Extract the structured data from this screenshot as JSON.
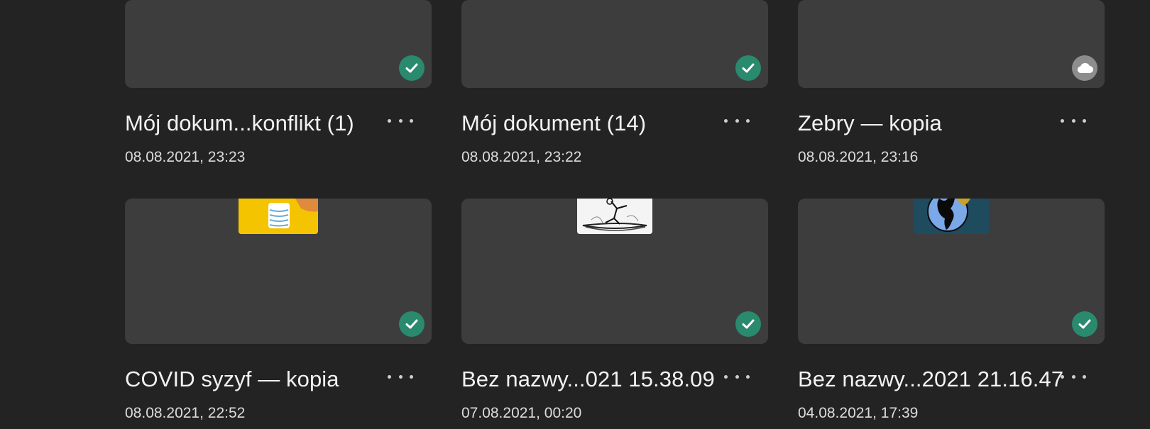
{
  "status_colors": {
    "synced": "#2a8a6e",
    "cloud": "#8d8d8d"
  },
  "documents": [
    {
      "name": "Mój dokum...konflikt (1)",
      "date": "08.08.2021, 23:23",
      "status": "synced",
      "status_icon": "checkmark-icon"
    },
    {
      "name": "Mój dokument (14)",
      "date": "08.08.2021, 23:22",
      "status": "synced",
      "status_icon": "checkmark-icon"
    },
    {
      "name": "Zebry — kopia",
      "date": "08.08.2021, 23:16",
      "status": "cloud",
      "status_icon": "cloud-icon"
    },
    {
      "name": "COVID syzyf — kopia",
      "date": "08.08.2021, 22:52",
      "status": "synced",
      "status_icon": "checkmark-icon"
    },
    {
      "name": "Bez nazwy...021 15.38.09",
      "date": "07.08.2021, 00:20",
      "status": "synced",
      "status_icon": "checkmark-icon"
    },
    {
      "name": "Bez nazwy...2021 21.16.47",
      "date": "04.08.2021, 17:39",
      "status": "synced",
      "status_icon": "checkmark-icon"
    }
  ]
}
